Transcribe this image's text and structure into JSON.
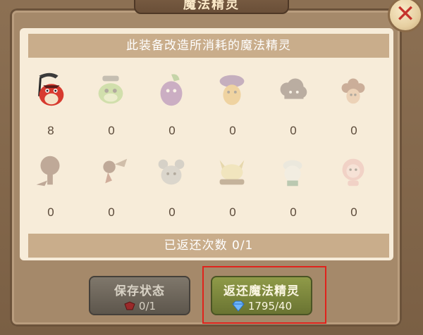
{
  "title": "魔法精灵",
  "close_label": "✕",
  "header": "此装备改造所消耗的魔法精灵",
  "sprites_row1": [
    {
      "icon": "red-reaper-sprite-icon",
      "count": "8",
      "owned": true
    },
    {
      "icon": "green-frog-sprite-icon",
      "count": "0",
      "owned": false
    },
    {
      "icon": "purple-eggplant-sprite-icon",
      "count": "0",
      "owned": false
    },
    {
      "icon": "mushroom-hat-sprite-icon",
      "count": "0",
      "owned": false
    },
    {
      "icon": "dark-cloud-sprite-icon",
      "count": "0",
      "owned": false
    },
    {
      "icon": "brown-flower-sprite-icon",
      "count": "0",
      "owned": false
    }
  ],
  "sprites_row2": [
    {
      "icon": "brown-tree-sprite-icon",
      "count": "0",
      "owned": false
    },
    {
      "icon": "winged-tree-sprite-icon",
      "count": "0",
      "owned": false
    },
    {
      "icon": "grey-mouse-sprite-icon",
      "count": "0",
      "owned": false
    },
    {
      "icon": "eared-cheese-sprite-icon",
      "count": "0",
      "owned": false
    },
    {
      "icon": "white-bearded-sprite-icon",
      "count": "0",
      "owned": false
    },
    {
      "icon": "pink-lion-sprite-icon",
      "count": "0",
      "owned": false
    }
  ],
  "footer": "已返还次数 0/1",
  "buttons": {
    "save": {
      "label": "保存状态",
      "cost": "0/1",
      "cost_icon": "ruby-icon"
    },
    "return": {
      "label": "返还魔法精灵",
      "cost": "1795/40",
      "cost_icon": "diamond-icon"
    }
  },
  "colors": {
    "frame": "#8a6f52",
    "parchment": "#f7ecd9",
    "band": "#c9ad8b",
    "highlight": "#e0231c",
    "return_button": "#7f8a3e"
  }
}
